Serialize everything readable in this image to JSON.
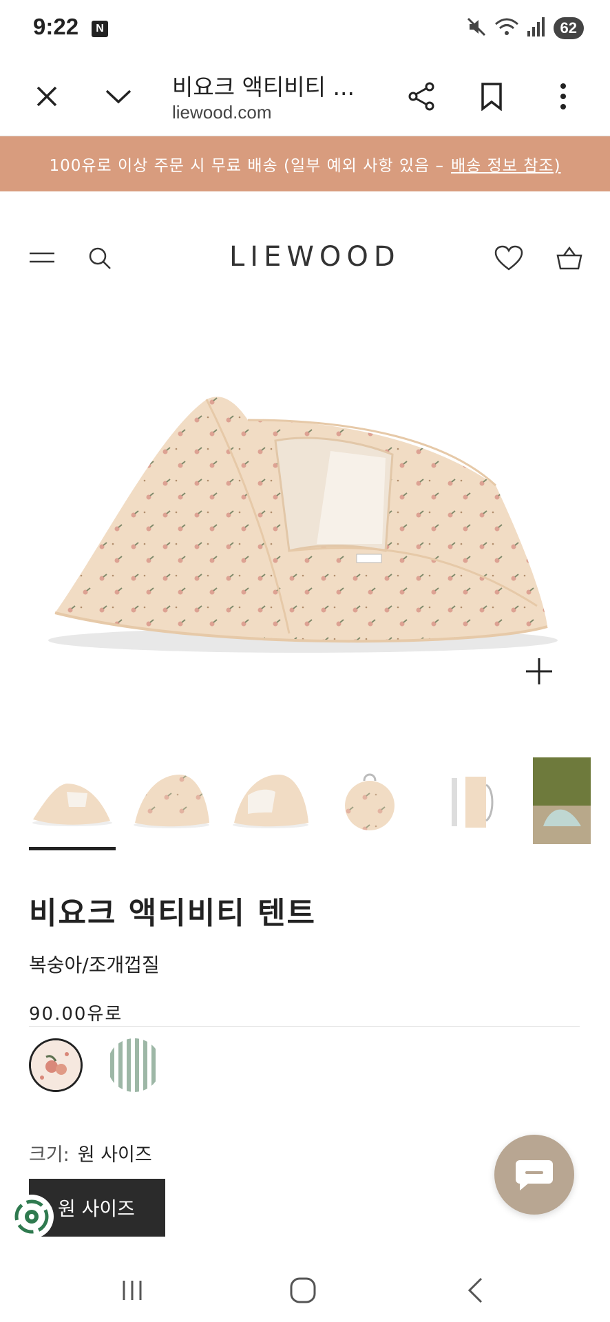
{
  "status_bar": {
    "time": "9:22",
    "notification_badge": "N",
    "battery": "62",
    "icons": [
      "mute-icon",
      "wifi-icon",
      "signal-icon"
    ]
  },
  "browser": {
    "title": "비요크 액티비티 ...",
    "url": "liewood.com",
    "buttons": [
      "close-icon",
      "chevron-down-icon",
      "share-icon",
      "bookmark-icon",
      "more-icon"
    ]
  },
  "promo": {
    "text": "100유로 이상 주문 시 무료 배송 (일부 예외 사항 있음 –",
    "link": "배송 정보 참조)",
    "color": "#d89c7e"
  },
  "header": {
    "logo": "LIEWOOD",
    "icons": [
      "menu-icon",
      "search-icon",
      "heart-icon",
      "basket-icon"
    ]
  },
  "product": {
    "name": "비요크 액티비티 텐트",
    "variant": "복숭아/조개껍질",
    "price": "90.00유로",
    "size_label": "크기:",
    "size_value": "원 사이즈",
    "size_button": "원 사이즈",
    "swatches": [
      {
        "name": "peach-seashell",
        "selected": true
      },
      {
        "name": "stripe-green",
        "selected": false
      }
    ],
    "thumbnails_count": 6,
    "active_thumbnail": 1
  },
  "colors": {
    "promo_bg": "#d89c7e",
    "tent_fabric": "#f1dcc4",
    "dark_button": "#2b2b2b",
    "chat_fab": "#b8a692"
  }
}
